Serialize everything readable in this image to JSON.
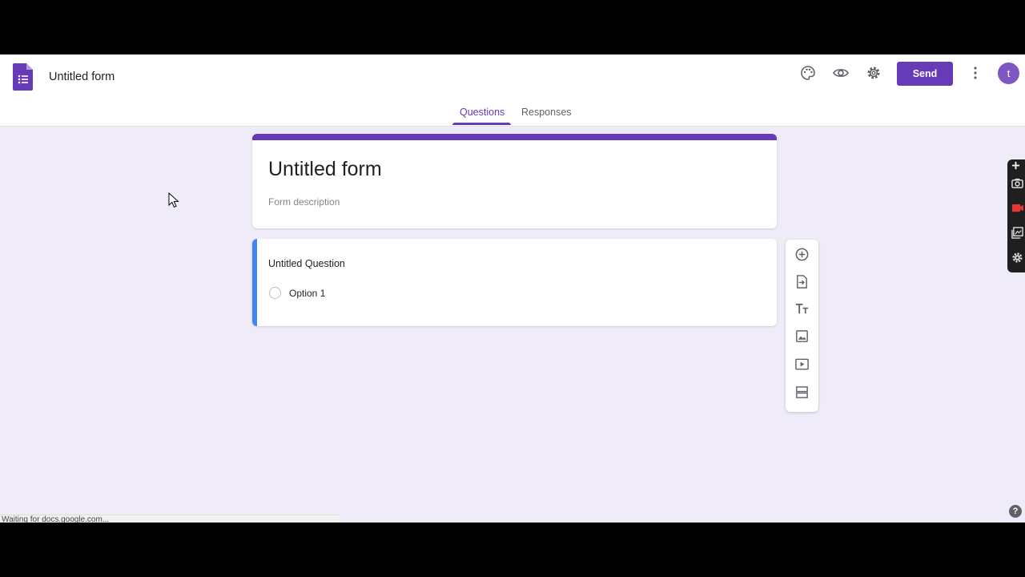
{
  "header": {
    "doc_title": "Untitled form",
    "send_label": "Send",
    "avatar_initial": "t",
    "icons": [
      "palette-icon",
      "eye-icon",
      "gear-icon",
      "more-vert-icon"
    ]
  },
  "tabs": [
    {
      "label": "Questions",
      "active": true
    },
    {
      "label": "Responses",
      "active": false
    }
  ],
  "form": {
    "title": "Untitled form",
    "description_placeholder": "Form description"
  },
  "question": {
    "title": "Untitled Question",
    "options": [
      "Option 1"
    ]
  },
  "toolbar": {
    "tools": [
      "add-question-icon",
      "import-questions-icon",
      "add-title-icon",
      "add-image-icon",
      "add-video-icon",
      "add-section-icon"
    ]
  },
  "status": {
    "text": "Waiting for docs.google.com..."
  },
  "colors": {
    "accent": "#673ab7",
    "background": "#f0ebf8",
    "question_focus": "#4285f4"
  }
}
